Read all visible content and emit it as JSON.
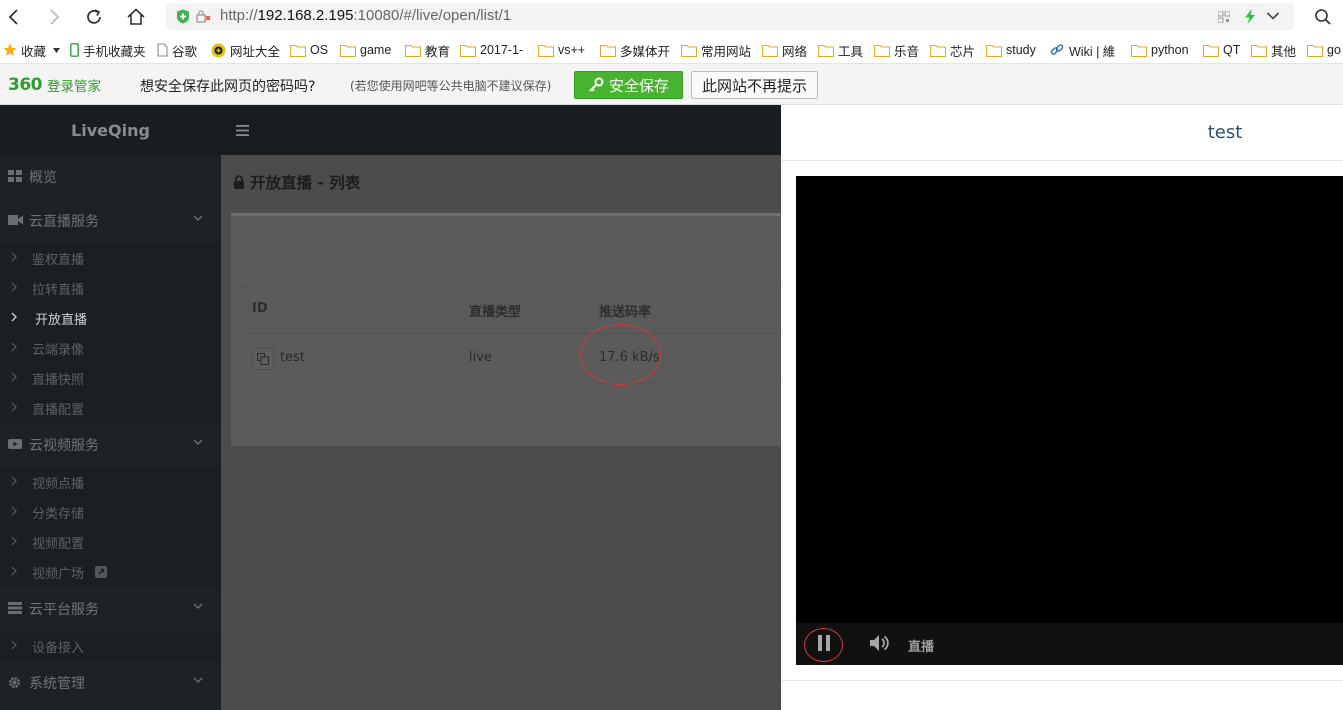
{
  "browser": {
    "url_protocol": "http://",
    "url_host": "192.168.2.195",
    "url_rest": ":10080/#/live/open/list/1"
  },
  "bookmarks": [
    {
      "label": "收藏",
      "icon": "star-icon"
    },
    {
      "label": "手机收藏夹",
      "icon": "phone-icon"
    },
    {
      "label": "谷歌",
      "icon": "page-icon"
    },
    {
      "label": "网址大全",
      "icon": "globe-icon"
    },
    {
      "label": "OS",
      "icon": "folder-icon"
    },
    {
      "label": "game",
      "icon": "folder-icon"
    },
    {
      "label": "教育",
      "icon": "folder-icon"
    },
    {
      "label": "2017-1-",
      "icon": "folder-icon"
    },
    {
      "label": "vs++",
      "icon": "folder-icon"
    },
    {
      "label": "多媒体开",
      "icon": "folder-icon"
    },
    {
      "label": "常用网站",
      "icon": "folder-icon"
    },
    {
      "label": "网络",
      "icon": "folder-icon"
    },
    {
      "label": "工具",
      "icon": "folder-icon"
    },
    {
      "label": "乐音",
      "icon": "folder-icon"
    },
    {
      "label": "芯片",
      "icon": "folder-icon"
    },
    {
      "label": "study",
      "icon": "folder-icon"
    },
    {
      "label": "Wiki | 維",
      "icon": "link-icon"
    },
    {
      "label": "python",
      "icon": "folder-icon"
    },
    {
      "label": "QT",
      "icon": "folder-icon"
    },
    {
      "label": "其他",
      "icon": "folder-icon"
    },
    {
      "label": "go",
      "icon": "folder-icon"
    }
  ],
  "pwbar": {
    "logo_num": "360",
    "logo_text": "登录管家",
    "question": "想安全保存此网页的密码吗?",
    "note": "(若您使用网吧等公共电脑不建议保存)",
    "save_label": "安全保存",
    "never_label": "此网站不再提示"
  },
  "app": {
    "brand": "LiveQing",
    "sidebar": {
      "overview": "概览",
      "cloud_live": "云直播服务",
      "live_items": [
        "鉴权直播",
        "拉转直播",
        "开放直播",
        "云端录像",
        "直播快照",
        "直播配置"
      ],
      "cloud_video": "云视频服务",
      "video_items": [
        "视频点播",
        "分类存储",
        "视频配置",
        "视频广场"
      ],
      "cloud_platform": "云平台服务",
      "platform_items": [
        "设备接入"
      ],
      "system": "系统管理"
    },
    "page_title": "开放直播 - 列表",
    "table": {
      "headers": [
        "ID",
        "直播类型",
        "推送码率"
      ],
      "rows": [
        {
          "id": "test",
          "type": "live",
          "rate": "17.6 kB/s"
        }
      ]
    }
  },
  "panel": {
    "title": "test",
    "live_label": "直播"
  },
  "colors": {
    "accent_green": "#47b331",
    "sidebar_bg": "#1e2224",
    "title_blue": "#2c4f74",
    "annotation_red": "#d23a3a"
  }
}
